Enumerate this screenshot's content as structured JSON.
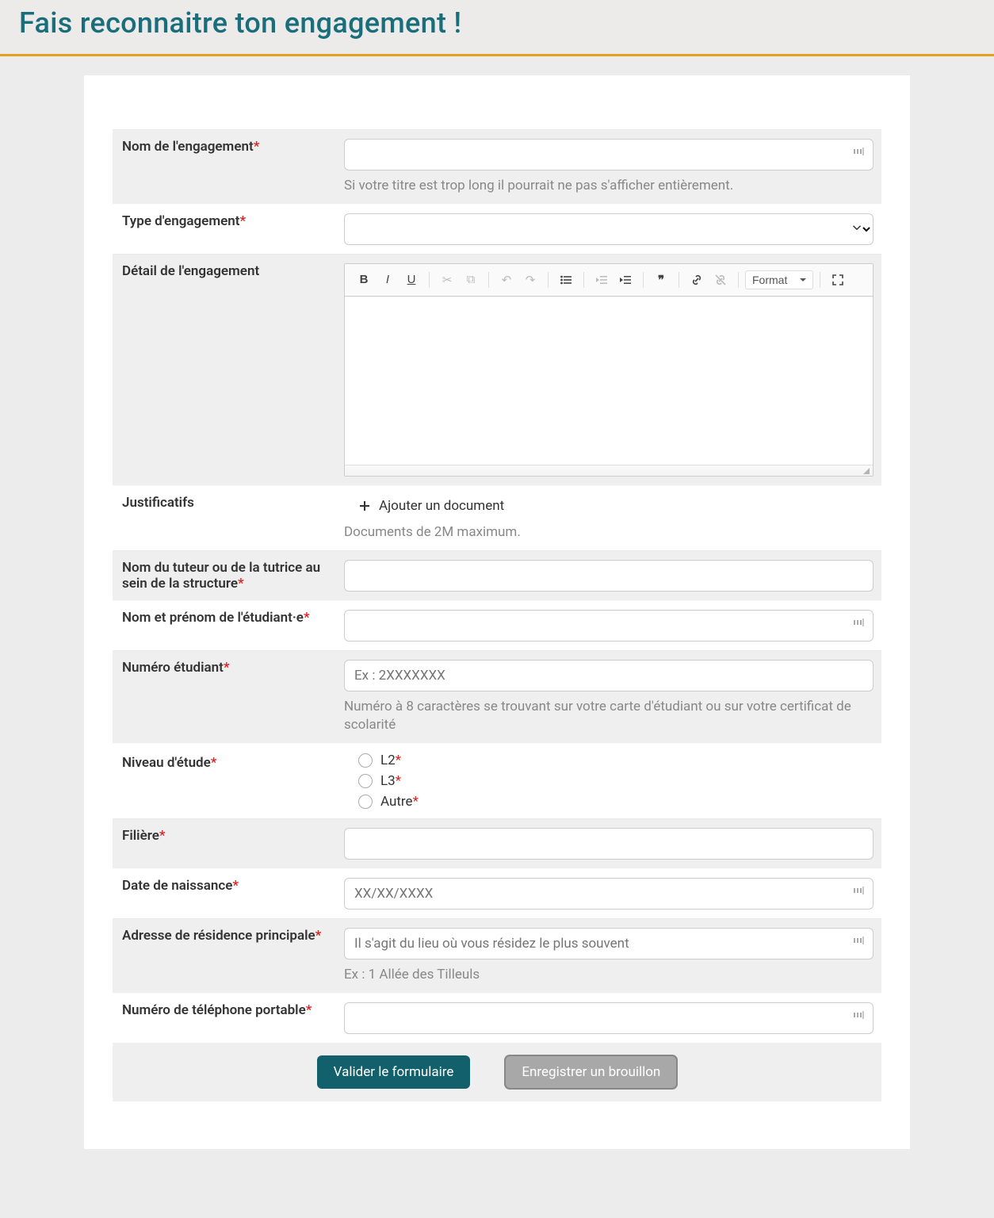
{
  "header": {
    "title": "Fais reconnaitre ton engagement !"
  },
  "form": {
    "engagement_name": {
      "label": "Nom de l'engagement",
      "value": "",
      "helper": "Si votre titre est trop long il pourrait ne pas s'afficher entièrement."
    },
    "engagement_type": {
      "label": "Type d'engagement",
      "selected": ""
    },
    "detail": {
      "label": "Détail de l'engagement",
      "format_label": "Format"
    },
    "justificatifs": {
      "label": "Justificatifs",
      "add_label": "Ajouter un document",
      "helper": "Documents de 2M maximum."
    },
    "tutor_name": {
      "label": "Nom du tuteur ou de la tutrice au sein de la structure",
      "value": ""
    },
    "student_name": {
      "label": "Nom et prénom de l'étudiant·e",
      "value": ""
    },
    "student_number": {
      "label": "Numéro étudiant",
      "placeholder": "Ex : 2XXXXXXX",
      "value": "",
      "helper": "Numéro à 8 caractères se trouvant sur votre carte d'étudiant ou sur votre certificat de scolarité"
    },
    "study_level": {
      "label": "Niveau d'étude",
      "options": [
        {
          "label": "L2"
        },
        {
          "label": "L3"
        },
        {
          "label": "Autre"
        }
      ]
    },
    "filiere": {
      "label": "Filière",
      "value": ""
    },
    "dob": {
      "label": "Date de naissance",
      "placeholder": "XX/XX/XXXX",
      "value": ""
    },
    "address": {
      "label": "Adresse de résidence principale",
      "placeholder": "Il s'agit du lieu où vous résidez le plus souvent",
      "value": "",
      "helper": "Ex : 1 Allée des Tilleuls"
    },
    "mobile": {
      "label": "Numéro de téléphone portable",
      "value": ""
    }
  },
  "buttons": {
    "submit": "Valider le formulaire",
    "draft": "Enregistrer un brouillon"
  }
}
